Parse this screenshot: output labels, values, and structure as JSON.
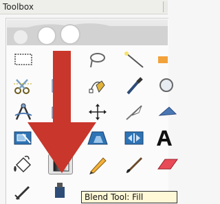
{
  "window": {
    "title": "Toolbox"
  },
  "tools": [
    {
      "name": "rect-select-tool"
    },
    {
      "name": "free-select-tool"
    },
    {
      "name": "paths-tool"
    },
    {
      "name": "color-picker-tool"
    },
    {
      "name": "scissors-select-tool"
    },
    {
      "name": "foreground-select-tool"
    },
    {
      "name": "paths-pen-tool"
    },
    {
      "name": "eyedropper-tool"
    },
    {
      "name": "zoom-tool"
    },
    {
      "name": "align-tool"
    },
    {
      "name": "move-tool"
    },
    {
      "name": "crop-tool"
    },
    {
      "name": "rotate-tool"
    },
    {
      "name": "scale-tool"
    },
    {
      "name": "shear-tool"
    },
    {
      "name": "perspective-tool"
    },
    {
      "name": "flip-tool"
    },
    {
      "name": "text-tool"
    },
    {
      "name": "bucket-fill-tool"
    },
    {
      "name": "blend-tool"
    },
    {
      "name": "pencil-tool"
    },
    {
      "name": "paintbrush-tool"
    },
    {
      "name": "eraser-tool"
    },
    {
      "name": "airbrush-tool"
    },
    {
      "name": "ink-tool"
    }
  ],
  "tooltip": {
    "text": "Blend Tool: Fill"
  },
  "colors": {
    "arrow": "#c9362b",
    "tooltip_bg": "#fff9d8"
  }
}
